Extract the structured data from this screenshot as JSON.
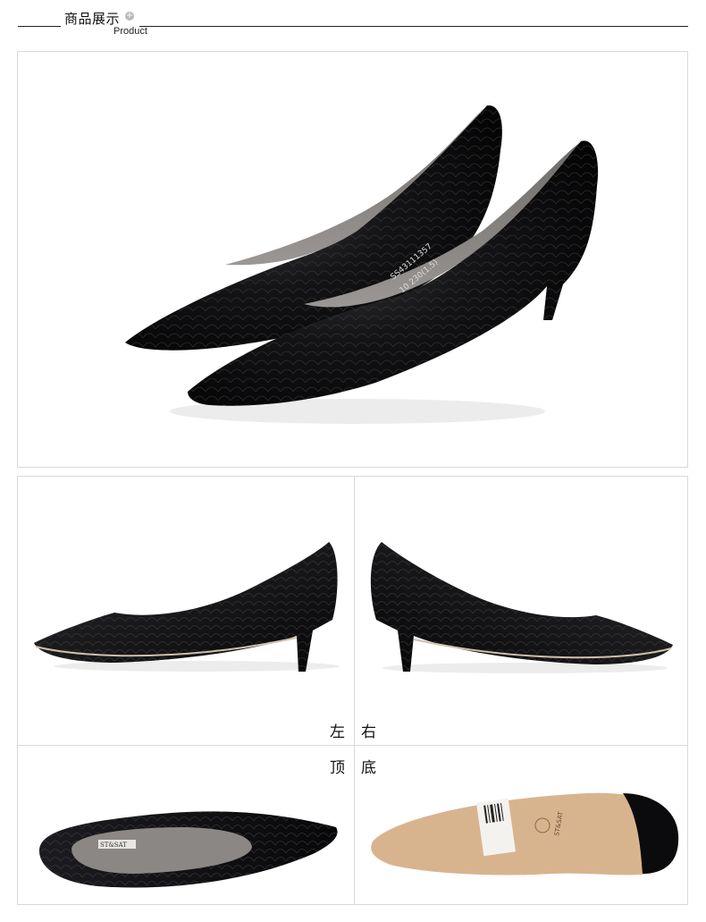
{
  "header": {
    "title_cn": "商品展示",
    "title_en": "Product",
    "plus_icon": "plus-circle-icon"
  },
  "views": {
    "left": "左",
    "right": "右",
    "top": "顶",
    "bottom": "底"
  },
  "images": {
    "main": "black snakeskin pointed pump pair",
    "left_view": "left side view",
    "right_view": "right side view",
    "top_view": "top view",
    "bottom_view": "sole view"
  },
  "shoe_insole_text": [
    "ST&SAT",
    "SS43111357",
    "10 230(1.5)"
  ],
  "colors": {
    "shoe": "#0d0d0f",
    "sole": "#d8b48e",
    "lining": "#8b8784",
    "border": "#d9d9d9"
  }
}
